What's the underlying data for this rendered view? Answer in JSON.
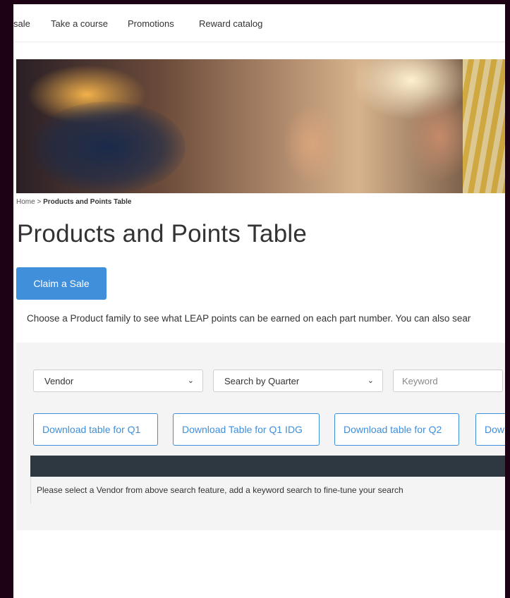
{
  "nav": {
    "items": [
      {
        "label": "sale"
      },
      {
        "label": "Take a course"
      },
      {
        "label": "Promotions"
      },
      {
        "label": "Reward catalog"
      }
    ]
  },
  "breadcrumb": {
    "home": "Home",
    "separator": " > ",
    "current": "Products and Points Table"
  },
  "page": {
    "title": "Products and Points Table",
    "claim_button": "Claim a Sale",
    "intro": "Choose a Product family to see what LEAP points can be earned on each part number. You can also sear"
  },
  "filters": {
    "vendor": "Vendor",
    "quarter": "Search by Quarter",
    "keyword_placeholder": "Keyword"
  },
  "downloads": [
    {
      "label": "Download table for Q1"
    },
    {
      "label": "Download Table for Q1 IDG"
    },
    {
      "label": "Download table for Q2"
    },
    {
      "label": "Dow"
    }
  ],
  "table": {
    "message": "Please select a Vendor from above search feature, add a keyword search to fine-tune your search"
  },
  "colors": {
    "accent": "#3f8fdb",
    "table_header": "#2d3841",
    "panel_bg": "#f4f4f4",
    "outer_bg": "#1c0212"
  },
  "icons": {
    "select_chevron": "chevron-down-icon"
  }
}
